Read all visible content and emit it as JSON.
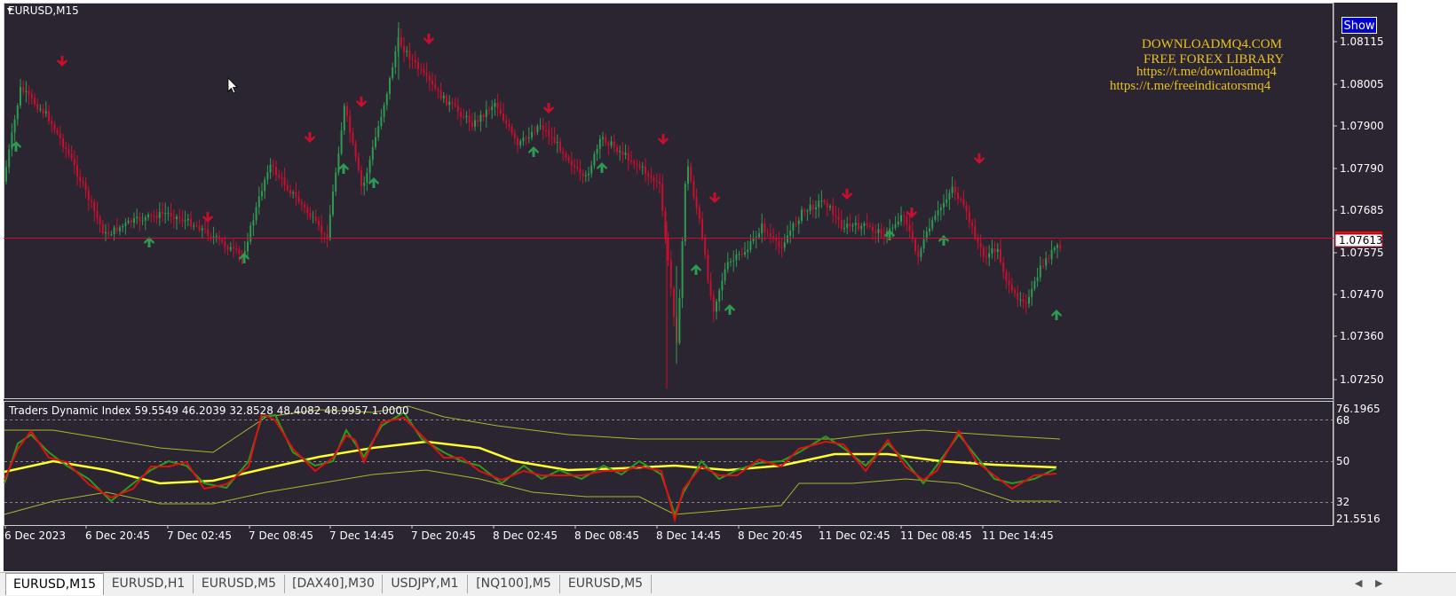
{
  "chart": {
    "symbol_label": "EURUSD,M15",
    "show_button": "Show",
    "watermark": [
      "DOWNLOADMQ4.COM",
      "FREE FOREX LIBRARY",
      "https://t.me/downloadmq4",
      "https://t.me/freeindicatorsmq4"
    ],
    "current_price": "1.07613",
    "price_axis": [
      "1.08115",
      "1.08005",
      "1.07900",
      "1.07790",
      "1.07685",
      "1.07575",
      "1.07470",
      "1.07360",
      "1.07250"
    ],
    "time_axis": [
      "6 Dec 2023",
      "6 Dec 20:45",
      "7 Dec 02:45",
      "7 Dec 08:45",
      "7 Dec 14:45",
      "7 Dec 20:45",
      "8 Dec 02:45",
      "8 Dec 08:45",
      "8 Dec 14:45",
      "8 Dec 20:45",
      "11 Dec 02:45",
      "11 Dec 08:45",
      "11 Dec 14:45"
    ],
    "colors": {
      "background": "#2b2431",
      "bull": "#2e9b52",
      "bear": "#c8102e",
      "price_line": "#c8102e",
      "watermark": "#e8c21e"
    }
  },
  "indicator": {
    "label": "Traders Dynamic Index 59.5549 46.2039 32.8528 48.4082 48.9957 1.0000",
    "axis": [
      "76.1965",
      "68",
      "50",
      "32",
      "21.5516"
    ],
    "colors": {
      "rsi": "#2e9b1e",
      "signal": "#e01010",
      "base": "#ffff30",
      "bands": "#a8b830"
    }
  },
  "tabs": [
    "EURUSD,M15",
    "EURUSD,H1",
    "EURUSD,M5",
    "[DAX40],M30",
    "USDJPY,M1",
    "[NQ100],M5",
    "EURUSD,M5"
  ],
  "active_tab": "EURUSD,M15",
  "icons": {
    "collapse": "triangle-down-icon",
    "cursor": "mouse-pointer-icon",
    "tab_left": "arrow-left-icon",
    "tab_right": "arrow-right-icon"
  }
}
